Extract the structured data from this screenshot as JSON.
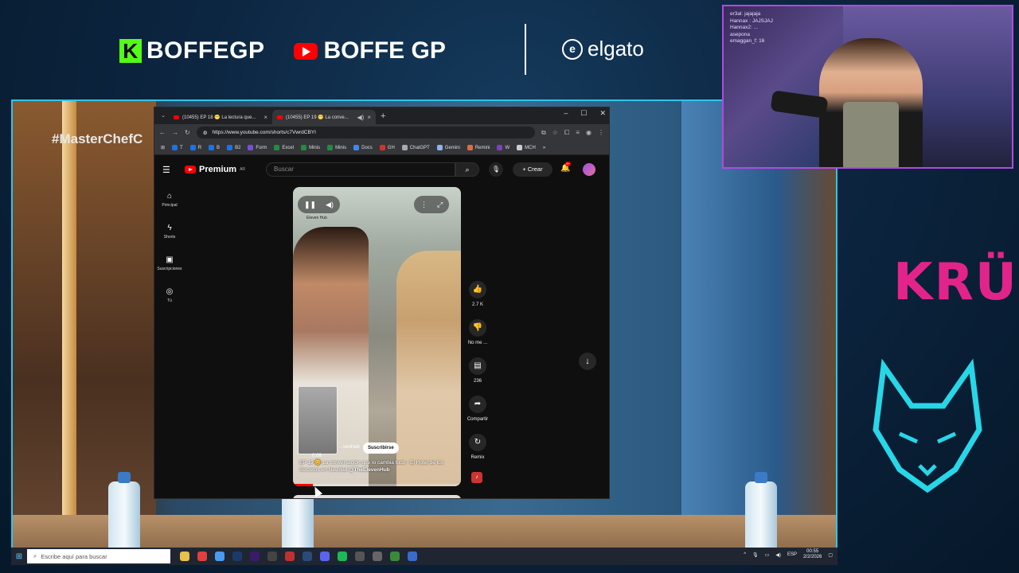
{
  "overlay": {
    "kick_handle": "BOFFEGP",
    "youtube_handle": "BOFFE GP",
    "sponsor": "elgato",
    "side_logo": "KRÜ",
    "hashtag": "#MasterChefC",
    "webcam_chat": [
      "er3al: jajajaja",
      "Hannax : JAJSJAJ",
      "Hannax2: ...",
      "asepona",
      "emaggan_f: 16"
    ]
  },
  "browser": {
    "tabs": [
      {
        "label": "(10455) EP 18 😁 La lectura que..."
      },
      {
        "label": "(10455) EP 19 😁 La conve..."
      }
    ],
    "url": "https://www.youtube.com/shorts/c7VwrdCBYI",
    "bookmarks": [
      "T",
      "R",
      "B",
      "B2",
      "Form",
      "Excel",
      "Minis",
      "Minis",
      "Docs",
      "GH",
      "ChatGPT",
      "Gemini",
      "Remini",
      "W",
      "MCH"
    ],
    "bookmark_colors": [
      "#1a73e8",
      "#1a73e8",
      "#1a73e8",
      "#1a73e8",
      "#7b4be0",
      "#1e8e3e",
      "#1e8e3e",
      "#1e8e3e",
      "#4285f4",
      "#d93025",
      "#aaaaaa",
      "#8ab4f8",
      "#e06c3c",
      "#7f3fbf",
      "#cccccc"
    ]
  },
  "youtube": {
    "logo_text": "Premium",
    "logo_sup": "AR",
    "search_placeholder": "Buscar",
    "crear_label": "Crear",
    "bell_count": "9+",
    "sidebar": [
      {
        "icon": "home-icon",
        "label": "Principal"
      },
      {
        "icon": "shorts-icon",
        "label": "Shorts"
      },
      {
        "icon": "subscriptions-icon",
        "label": "Suscripciones"
      },
      {
        "icon": "you-icon",
        "label": "Tú"
      }
    ],
    "short": {
      "channel_mini": "Eleven Hub",
      "channel_name": "...venHub",
      "subscribe_label": "Suscribirse",
      "time": "0:06",
      "description": "EP 19 😊 La conversación que lo cambia todo - El Hotel de los Secretos en Navidad",
      "handle": "@TheElevenHub",
      "progress": 0.12
    },
    "actions": [
      {
        "icon": "like-icon",
        "label": "2.7 K"
      },
      {
        "icon": "dislike-icon",
        "label": "No me ..."
      },
      {
        "icon": "comment-icon",
        "label": "236"
      },
      {
        "icon": "share-icon",
        "label": "Compartir"
      },
      {
        "icon": "remix-icon",
        "label": "Remix"
      }
    ]
  },
  "taskbar": {
    "search_placeholder": "Escribe aquí para buscar",
    "lang": "ESP",
    "time": "00:55",
    "date": "2/2/2026"
  }
}
